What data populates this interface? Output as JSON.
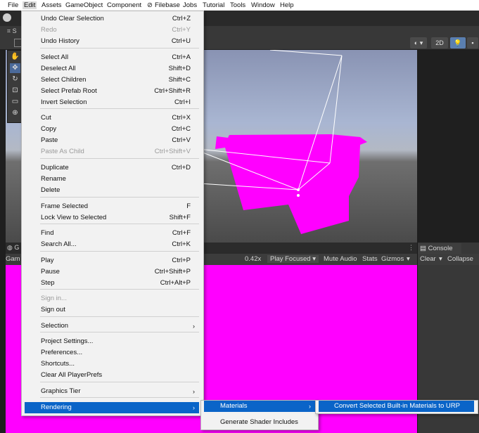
{
  "menubar": {
    "items": [
      "File",
      "Edit",
      "Assets",
      "GameObject",
      "Component",
      "Filebase",
      "Jobs",
      "Tutorial",
      "Tools",
      "Window",
      "Help"
    ]
  },
  "scene_toolbar": {
    "btn_2d": "2D"
  },
  "game_toolbar": {
    "tab_label": "Gam",
    "scale_value": "0.42x",
    "play_mode": "Play Focused",
    "mute": "Mute Audio",
    "stats": "Stats",
    "gizmos": "Gizmos"
  },
  "console": {
    "tab": "Console",
    "clear": "Clear",
    "collapse": "Collapse"
  },
  "edit_menu": {
    "items": [
      {
        "label": "Undo Clear Selection",
        "shortcut": "Ctrl+Z",
        "disabled": false
      },
      {
        "label": "Redo",
        "shortcut": "Ctrl+Y",
        "disabled": true
      },
      {
        "label": "Undo History",
        "shortcut": "Ctrl+U",
        "disabled": false
      },
      {
        "label": "Select All",
        "shortcut": "Ctrl+A",
        "disabled": false
      },
      {
        "label": "Deselect All",
        "shortcut": "Shift+D",
        "disabled": false
      },
      {
        "label": "Select Children",
        "shortcut": "Shift+C",
        "disabled": false
      },
      {
        "label": "Select Prefab Root",
        "shortcut": "Ctrl+Shift+R",
        "disabled": false
      },
      {
        "label": "Invert Selection",
        "shortcut": "Ctrl+I",
        "disabled": false
      },
      {
        "label": "Cut",
        "shortcut": "Ctrl+X",
        "disabled": false
      },
      {
        "label": "Copy",
        "shortcut": "Ctrl+C",
        "disabled": false
      },
      {
        "label": "Paste",
        "shortcut": "Ctrl+V",
        "disabled": false
      },
      {
        "label": "Paste As Child",
        "shortcut": "Ctrl+Shift+V",
        "disabled": true
      },
      {
        "label": "Duplicate",
        "shortcut": "Ctrl+D",
        "disabled": false
      },
      {
        "label": "Rename",
        "shortcut": "",
        "disabled": false
      },
      {
        "label": "Delete",
        "shortcut": "",
        "disabled": false
      },
      {
        "label": "Frame Selected",
        "shortcut": "F",
        "disabled": false
      },
      {
        "label": "Lock View to Selected",
        "shortcut": "Shift+F",
        "disabled": false
      },
      {
        "label": "Find",
        "shortcut": "Ctrl+F",
        "disabled": false
      },
      {
        "label": "Search All...",
        "shortcut": "Ctrl+K",
        "disabled": false
      },
      {
        "label": "Play",
        "shortcut": "Ctrl+P",
        "disabled": false
      },
      {
        "label": "Pause",
        "shortcut": "Ctrl+Shift+P",
        "disabled": false
      },
      {
        "label": "Step",
        "shortcut": "Ctrl+Alt+P",
        "disabled": false
      },
      {
        "label": "Sign in...",
        "shortcut": "",
        "disabled": true
      },
      {
        "label": "Sign out",
        "shortcut": "",
        "disabled": false
      },
      {
        "label": "Selection",
        "shortcut": "",
        "disabled": false,
        "submenu": true
      },
      {
        "label": "Project Settings...",
        "shortcut": "",
        "disabled": false
      },
      {
        "label": "Preferences...",
        "shortcut": "",
        "disabled": false
      },
      {
        "label": "Shortcuts...",
        "shortcut": "",
        "disabled": false
      },
      {
        "label": "Clear All PlayerPrefs",
        "shortcut": "",
        "disabled": false
      },
      {
        "label": "Graphics Tier",
        "shortcut": "",
        "disabled": false,
        "submenu": true
      },
      {
        "label": "Rendering",
        "shortcut": "",
        "disabled": false,
        "submenu": true,
        "highlighted": true
      }
    ]
  },
  "rendering_menu": {
    "items": [
      {
        "label": "Materials",
        "submenu": true,
        "highlighted": true
      },
      {
        "label": "Generate Shader Includes",
        "submenu": false,
        "highlighted": false
      }
    ]
  },
  "materials_menu": {
    "items": [
      {
        "label": "Convert Selected Built-in Materials to URP",
        "highlighted": true
      }
    ]
  },
  "colors": {
    "highlight": "#0a64c8",
    "magenta": "#ff00ff"
  }
}
